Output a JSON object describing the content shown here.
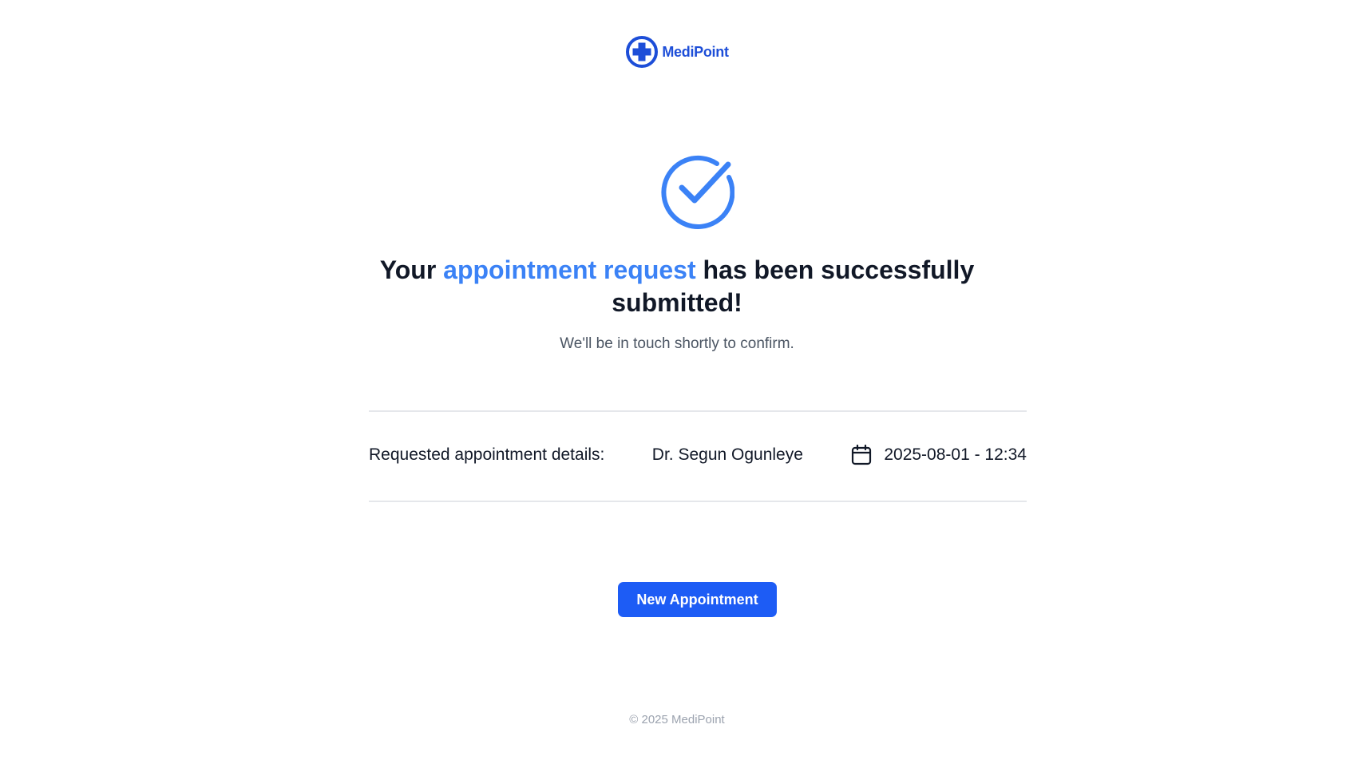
{
  "brand": {
    "name": "MediPoint",
    "logo_icon": "medical-cross-icon",
    "color": "#1d4ed8"
  },
  "confirmation": {
    "icon": "check-circle-icon",
    "headline_prefix": "Your",
    "headline_accent": "appointment request",
    "headline_suffix": "has been successfully submitted!",
    "subtext": "We'll be in touch shortly to confirm.",
    "accent_color": "#3b82f6"
  },
  "details": {
    "label": "Requested appointment details:",
    "doctor": "Dr. Segun Ogunleye",
    "datetime_icon": "calendar-icon",
    "datetime": "2025-08-01 - 12:34"
  },
  "actions": {
    "new_appointment_label": "New Appointment",
    "button_color": "#1d5cf5"
  },
  "footer": {
    "copyright": "© 2025 MediPoint"
  }
}
